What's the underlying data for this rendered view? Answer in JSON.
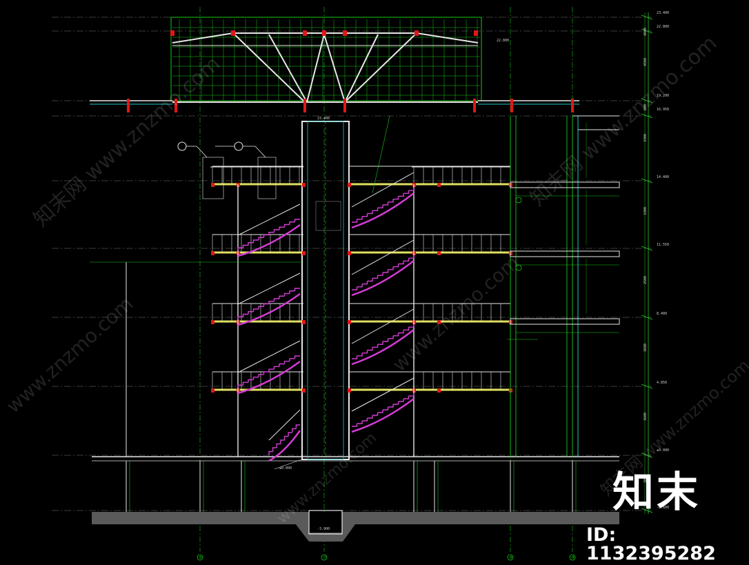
{
  "drawing": {
    "title": "",
    "colors": {
      "background": "#000000",
      "grid": "#18c818",
      "structure": "#e8e8e8",
      "stair": "#d43cd4",
      "slab_edge": "#e0e060",
      "column_mark": "#e01818",
      "ground": "#5a5a5a",
      "cyan": "#20c8c8",
      "dim_line": "#2ad22a"
    },
    "level_marks": [
      "23.400",
      "22.800",
      "19.200",
      "16.950",
      "14.400",
      "11.550",
      "8.400",
      "4.850",
      "±0.000",
      "-0.600"
    ],
    "shaft_marks": [
      "23.400",
      "-3.900"
    ],
    "axis_bubbles": [
      "⑥",
      "⑦",
      "⑧",
      "⑨"
    ],
    "dim_labels": [
      "4500",
      "3300",
      "3300",
      "2500",
      "3600",
      "3600",
      "3800",
      "4800",
      "600"
    ],
    "ground_tag": "±0.000"
  },
  "watermarks": [
    "www.znzmo.com",
    "知末网"
  ],
  "brand": {
    "logo_text": "知末",
    "id_text": "ID: 1132395282"
  }
}
